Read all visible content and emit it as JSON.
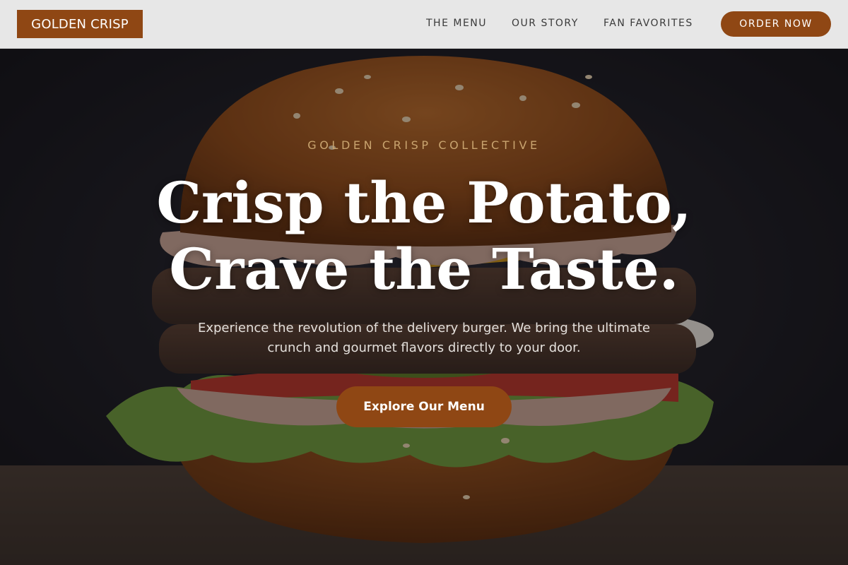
{
  "brand": {
    "name": "GOLDEN CRISP",
    "accent_color": "#8f4714"
  },
  "nav": {
    "links": [
      {
        "label": "THE MENU"
      },
      {
        "label": "OUR STORY"
      },
      {
        "label": "FAN FAVORITES"
      }
    ],
    "cta_label": "ORDER NOW"
  },
  "hero": {
    "eyebrow": "GOLDEN CRISP COLLECTIVE",
    "headline_line1": "Crisp the Potato,",
    "headline_line2": "Crave the Taste.",
    "subtitle": "Experience the revolution of the delivery burger. We bring the ultimate crunch and gourmet flavors directly to your door.",
    "cta_label": "Explore Our Menu",
    "background_image": "burger-photo"
  }
}
